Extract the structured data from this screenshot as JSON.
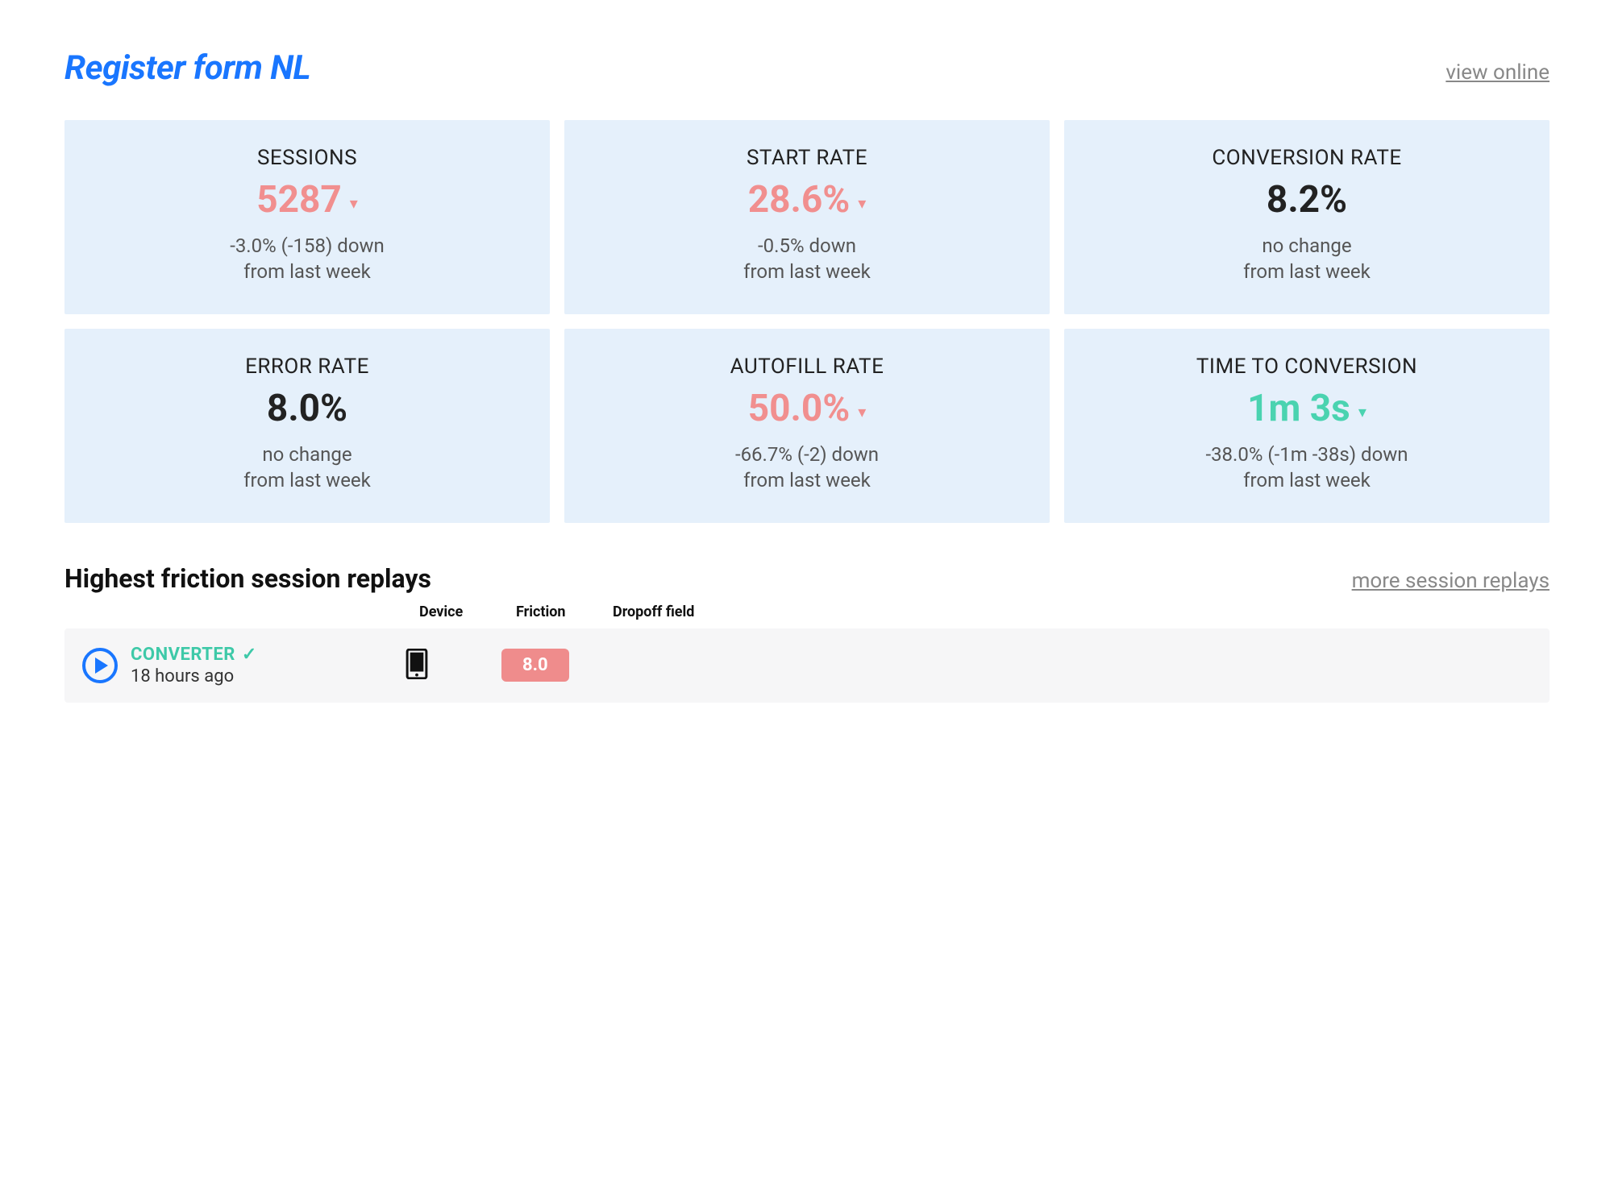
{
  "header": {
    "title": "Register form NL",
    "view_online": "view online"
  },
  "cards": [
    {
      "label": "SESSIONS",
      "value": "5287",
      "value_color": "pink",
      "caret": "▾",
      "caret_color": "pink",
      "delta_line1": "-3.0% (-158) down",
      "delta_line2": "from last week"
    },
    {
      "label": "START RATE",
      "value": "28.6%",
      "value_color": "pink",
      "caret": "▾",
      "caret_color": "pink",
      "delta_line1": "-0.5% down",
      "delta_line2": "from last week"
    },
    {
      "label": "CONVERSION RATE",
      "value": "8.2%",
      "value_color": "black",
      "caret": "",
      "caret_color": "",
      "delta_line1": "no change",
      "delta_line2": "from last week"
    },
    {
      "label": "ERROR RATE",
      "value": "8.0%",
      "value_color": "black",
      "caret": "",
      "caret_color": "",
      "delta_line1": "no change",
      "delta_line2": "from last week"
    },
    {
      "label": "AUTOFILL RATE",
      "value": "50.0%",
      "value_color": "pink",
      "caret": "▾",
      "caret_color": "pink",
      "delta_line1": "-66.7% (-2) down",
      "delta_line2": "from last week"
    },
    {
      "label": "TIME TO CONVERSION",
      "value": "1m 3s",
      "value_color": "teal",
      "caret": "▾",
      "caret_color": "teal",
      "delta_line1": "-38.0% (-1m -38s) down",
      "delta_line2": "from last week"
    }
  ],
  "replays": {
    "title": "Highest friction session replays",
    "more_link": "more session replays",
    "columns": {
      "device": "Device",
      "friction": "Friction",
      "dropoff": "Dropoff field"
    },
    "rows": [
      {
        "badge_label": "CONVERTER",
        "time_ago": "18 hours ago",
        "device": "mobile",
        "friction": "8.0",
        "dropoff": ""
      }
    ]
  }
}
